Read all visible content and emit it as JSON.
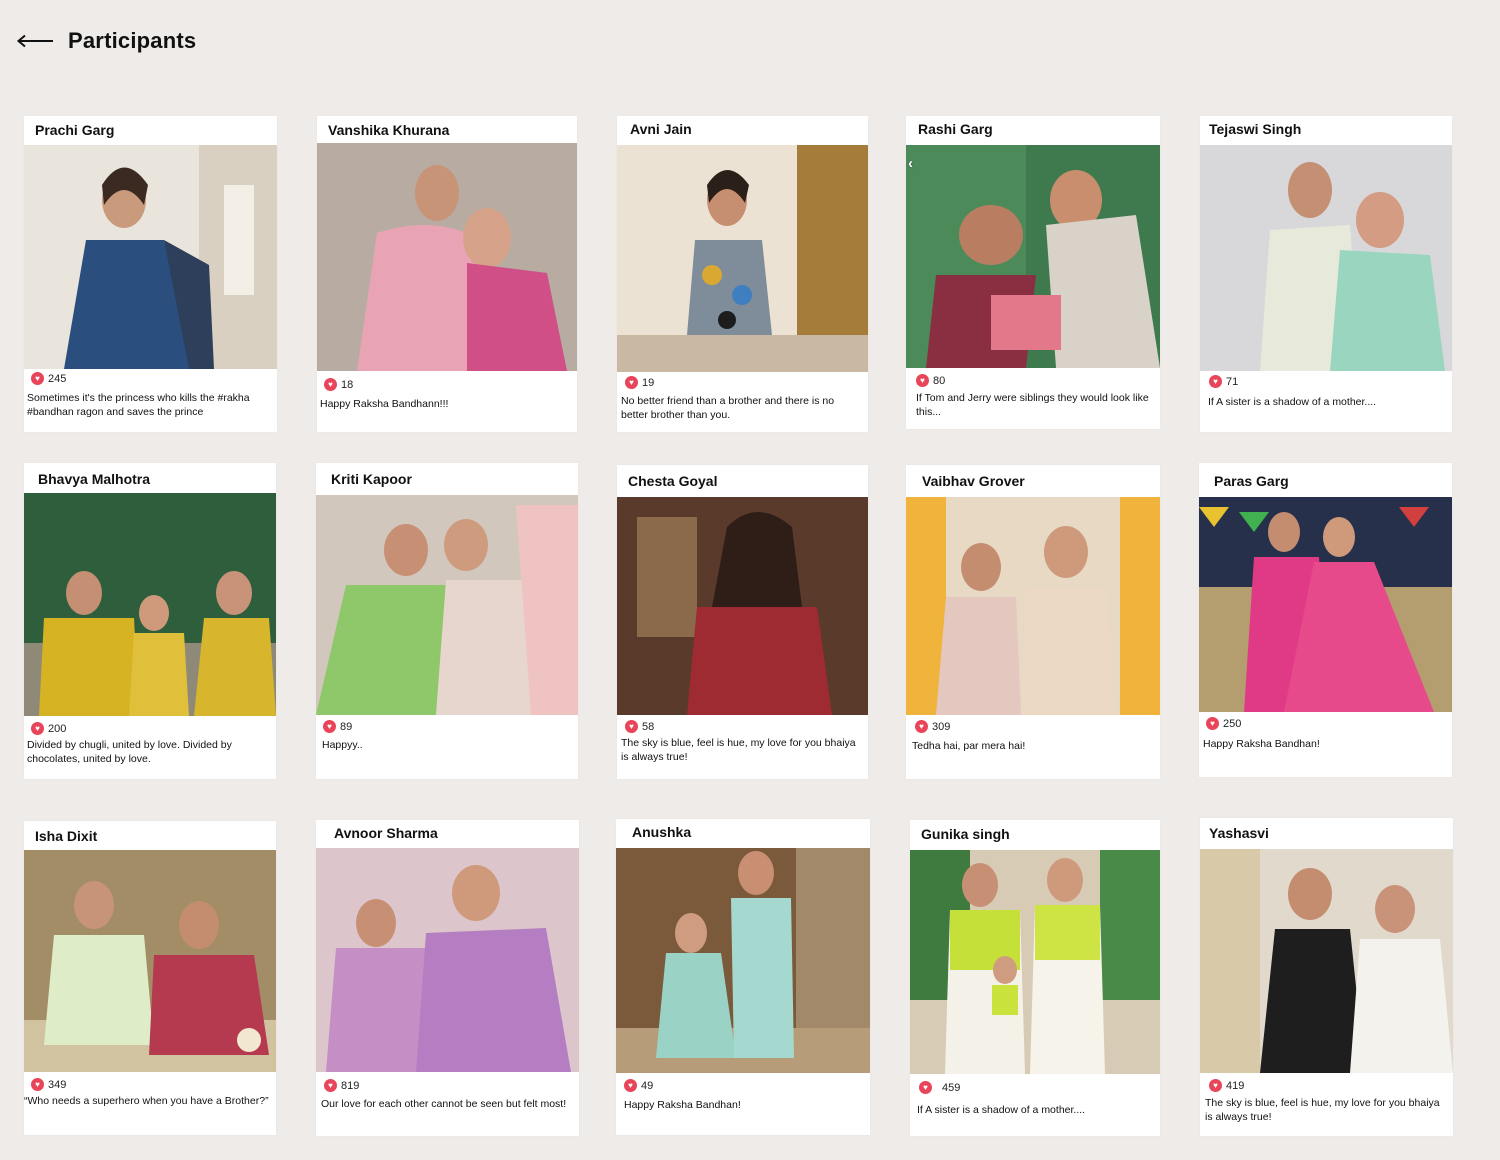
{
  "header": {
    "title": "Participants",
    "back_icon": "arrow-left-icon"
  },
  "like_icon": "heart-icon",
  "accent_color": "#e8455a",
  "cards": [
    {
      "name": "Prachi Garg",
      "likes": "245",
      "caption": "Sometimes it's the princess who kills the #rakha #bandhan ragon and saves the prince"
    },
    {
      "name": "Vanshika Khurana",
      "likes": "18",
      "caption": "Happy Raksha Bandhann!!!"
    },
    {
      "name": "Avni Jain",
      "likes": "19",
      "caption": "No better friend than a brother and there is no better brother than you."
    },
    {
      "name": "Rashi Garg",
      "likes": "80",
      "caption": "If Tom and Jerry were siblings they would look like this..."
    },
    {
      "name": "Tejaswi Singh",
      "likes": "71",
      "caption": "If A sister is a shadow of a mother...."
    },
    {
      "name": "Bhavya Malhotra",
      "likes": "200",
      "caption": "Divided by chugli, united by love. Divided by chocolates, united by love."
    },
    {
      "name": "Kriti Kapoor",
      "likes": "89",
      "caption": "Happyy.."
    },
    {
      "name": "Chesta Goyal",
      "likes": "58",
      "caption": "The sky is blue, feel is hue, my love for you bhaiya is always true!"
    },
    {
      "name": "Vaibhav Grover",
      "likes": "309",
      "caption": "Tedha hai, par mera hai!"
    },
    {
      "name": "Paras Garg",
      "likes": "250",
      "caption": "Happy Raksha Bandhan!"
    },
    {
      "name": "Isha Dixit",
      "likes": "349",
      "caption": "“Who needs a superhero when you have a Brother?”"
    },
    {
      "name": "Avnoor Sharma",
      "likes": "819",
      "caption": "Our love for each other cannot be seen but felt most!"
    },
    {
      "name": "Anushka",
      "likes": "49",
      "caption": "Happy Raksha Bandhan!"
    },
    {
      "name": "Gunika singh",
      "likes": "459",
      "caption": "If A sister is a shadow of a mother...."
    },
    {
      "name": "Yashasvi",
      "likes": "419",
      "caption": "The sky is blue, feel is hue, my love for you bhaiya is always true!"
    }
  ]
}
